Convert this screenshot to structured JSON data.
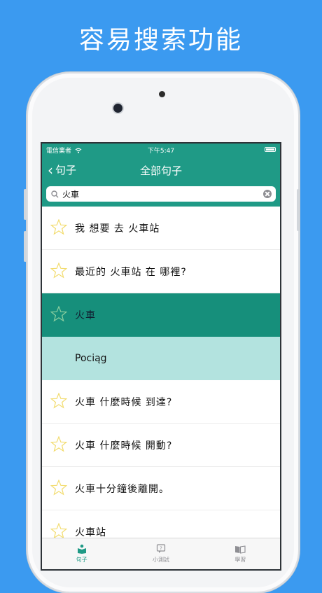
{
  "headline": "容易搜索功能",
  "status": {
    "carrier": "電信業者",
    "time": "下午5:47"
  },
  "nav": {
    "back_label": "句子",
    "title": "全部句子"
  },
  "search": {
    "value": "火車",
    "placeholder": ""
  },
  "rows": [
    {
      "text": "我 想要 去 火車站",
      "state": "normal"
    },
    {
      "text": "最近的 火車站 在 哪裡?",
      "state": "normal"
    },
    {
      "text": "火車",
      "state": "selected"
    },
    {
      "text": "Pociąg",
      "state": "translation"
    },
    {
      "text": "火車 什麼時候 到達?",
      "state": "normal"
    },
    {
      "text": "火車 什麼時候 開動?",
      "state": "normal"
    },
    {
      "text": "火車十分鐘後離開。",
      "state": "normal"
    },
    {
      "text": "火車站",
      "state": "normal"
    }
  ],
  "tabs": [
    {
      "label": "句子",
      "icon": "book-person-icon",
      "active": true
    },
    {
      "label": "小測試",
      "icon": "quiz-icon",
      "active": false
    },
    {
      "label": "學習",
      "icon": "open-book-icon",
      "active": false
    }
  ],
  "colors": {
    "background": "#3b9af0",
    "accent": "#1f9a86",
    "selected": "#168f7b",
    "translation": "#b3e3df",
    "star": "#f2dc6e"
  }
}
